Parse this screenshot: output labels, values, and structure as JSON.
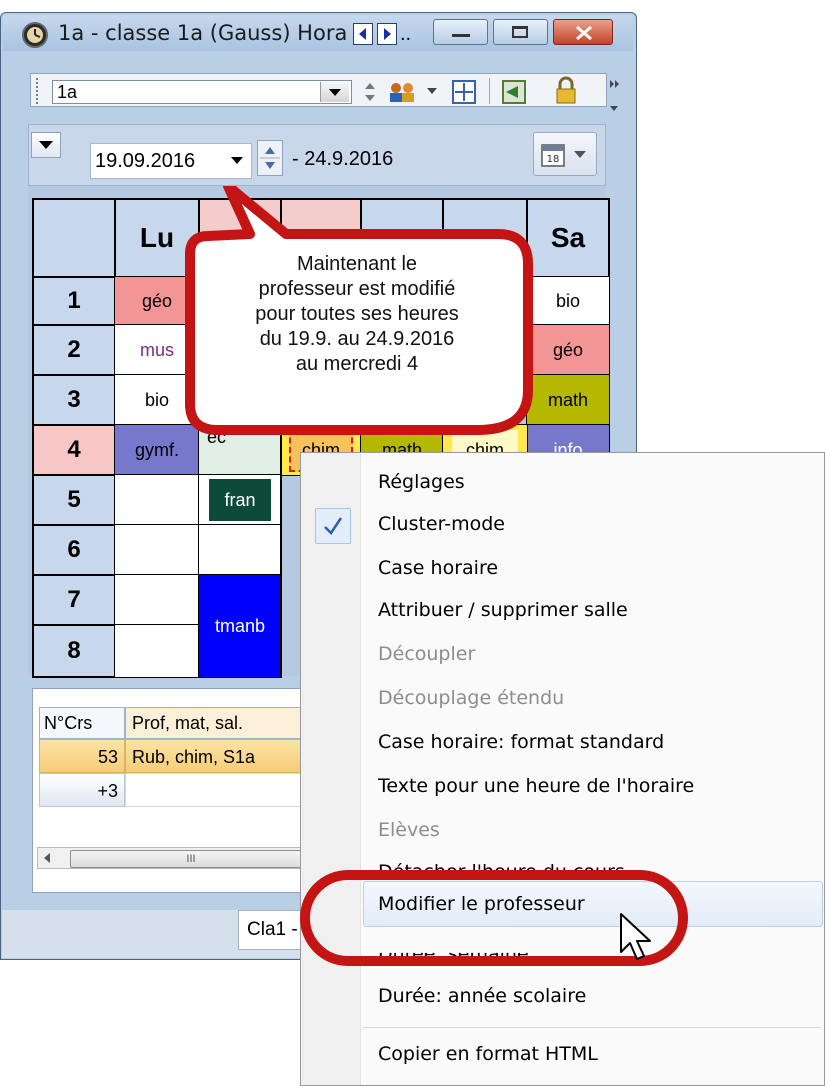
{
  "window": {
    "title": "1a - classe 1a (Gauss) Hora",
    "title_ellipsis": "..",
    "class_selector": "1a",
    "date_from": "19.09.2016",
    "date_to": "- 24.9.2016"
  },
  "timetable": {
    "days": [
      "Lu",
      "",
      "",
      "",
      "",
      "Sa"
    ],
    "rows": [
      "1",
      "2",
      "3",
      "4",
      "5",
      "6",
      "7",
      "8"
    ],
    "cells": {
      "lu1": "géo",
      "lu2": "mus",
      "lu3": "bio",
      "lu4": "gymf.",
      "sa1": "bio",
      "sa2": "géo",
      "sa3": "math",
      "sa4": "info",
      "ma5": "fran",
      "ma7": "tmanb",
      "ma4_partial": "ec",
      "me4": "chim",
      "je4": "math",
      "ve4": "chim"
    }
  },
  "bubble": {
    "line1": "Maintenant le",
    "line2": "professeur est modifié",
    "line3": "pour toutes ses heures",
    "line4": "du 19.9. au 24.9.2016",
    "line5": "au mercredi 4"
  },
  "lesson_table": {
    "col_no": "N°Crs",
    "col_info": "Prof, mat, sal.",
    "row1_no": "53",
    "row1_info": "Rub, chim, S1a",
    "row2_no": "+3"
  },
  "status": {
    "tab": "Cla1 -"
  },
  "scroll_mark": "III",
  "context_menu": {
    "items": [
      {
        "label": "Réglages",
        "enabled": true
      },
      {
        "label": "Cluster-mode",
        "enabled": true,
        "checked": true
      },
      {
        "label": "Case horaire",
        "enabled": true
      },
      {
        "label": "Attribuer / supprimer salle",
        "enabled": true
      },
      {
        "label": "Découpler",
        "enabled": false
      },
      {
        "label": "Découplage étendu",
        "enabled": false
      },
      {
        "label": "Case horaire: format standard",
        "enabled": true
      },
      {
        "label": "Texte pour une heure de l'horaire",
        "enabled": true
      },
      {
        "label": "Elèves",
        "enabled": false
      },
      {
        "label": "Détacher l'heure du cours",
        "enabled": true
      },
      {
        "label": "Modifier le professeur",
        "enabled": true,
        "highlighted": true
      },
      {
        "label": "Durée: semaine",
        "enabled": true
      },
      {
        "label": "Durée: année scolaire",
        "enabled": true
      },
      {
        "label": "Copier en format HTML",
        "enabled": true
      }
    ]
  },
  "colors": {
    "accent_red": "#c41414",
    "chrome_blue": "#b9cfe6",
    "pink": "#f39595",
    "olive": "#b5b800",
    "indigo": "#7777cc",
    "blue": "#0000ff",
    "dark_green": "#0d4b38"
  }
}
